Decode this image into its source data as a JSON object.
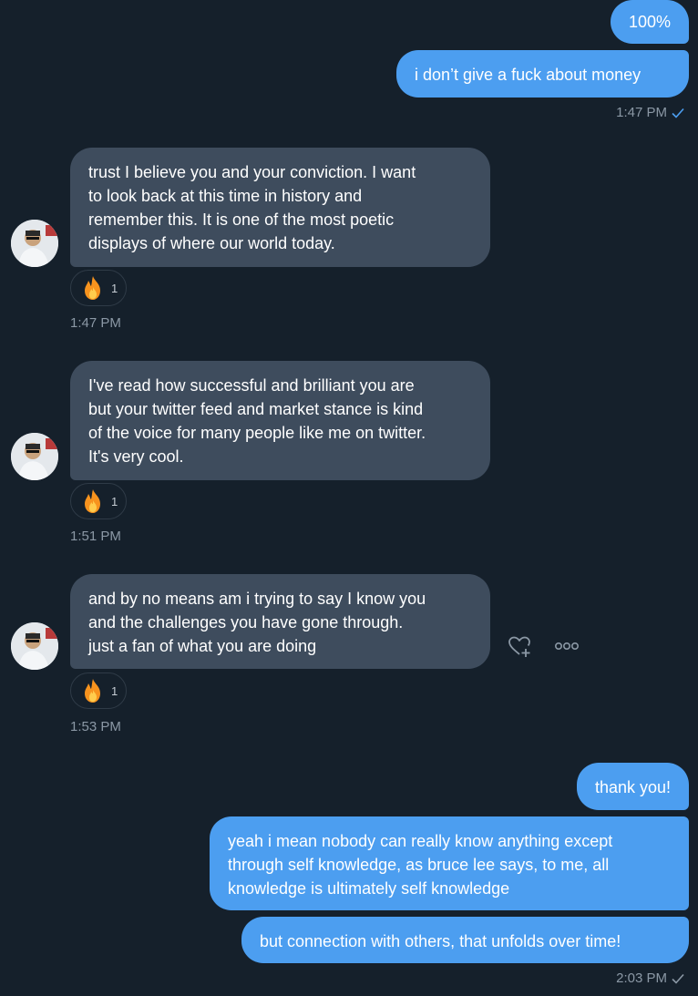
{
  "colors": {
    "background": "#15202b",
    "outgoing_bubble": "#4c9ef0",
    "incoming_bubble": "#3e4c5d",
    "timestamp": "#8b98a5"
  },
  "messages": {
    "m1": "100%",
    "m2": "i don’t give a fuck about money",
    "t1": "1:47 PM",
    "m3_l1": "trust I believe you and your conviction. I want",
    "m3_l2": "to look back at this time in history and",
    "m3_l3": "remember this. It is one of the most poetic",
    "m3_l4": "displays of where our world today.",
    "m3_reaction_count": "1",
    "t2": "1:47 PM",
    "m4_l1": "I've read  how successful and brilliant you are",
    "m4_l2": "but your twitter feed and market stance is kind",
    "m4_l3": "of the voice for many people like me on twitter.",
    "m4_l4": "It's very cool.",
    "m4_reaction_count": "1",
    "t3": "1:51 PM",
    "m5_l1": "and by no means am i trying to say I know you",
    "m5_l2": "and the challenges you have gone through.",
    "m5_l3": "just a fan of what you are doing",
    "m5_reaction_count": "1",
    "t4": "1:53 PM",
    "m6": "thank you!",
    "m7_l1": "yeah i mean nobody can really know anything except",
    "m7_l2": "through self knowledge, as bruce lee says, to me, all",
    "m7_l3": "knowledge is ultimately self knowledge",
    "m8": "but connection with others, that unfolds over time!",
    "t5": "2:03 PM"
  },
  "icons": {
    "reaction": "fire-emoji",
    "read_receipt": "checkmark-icon",
    "react": "heart-plus-icon",
    "more": "more-dots-icon"
  }
}
